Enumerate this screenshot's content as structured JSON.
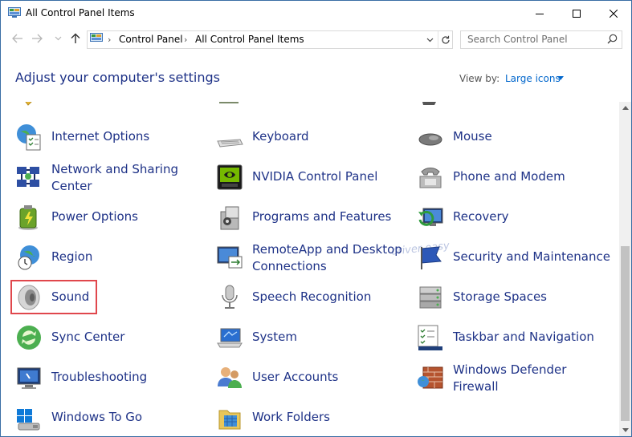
{
  "window": {
    "title": "All Control Panel Items",
    "title_icon": "control-panel-icon",
    "controls": [
      "minimize-icon",
      "maximize-icon",
      "close-icon"
    ]
  },
  "address": {
    "breadcrumbs": [
      "Control Panel",
      "All Control Panel Items"
    ],
    "search_placeholder": "Search Control Panel"
  },
  "header": {
    "title": "Adjust your computer's settings",
    "view_by_label": "View by:",
    "view_by_value": "Large icons"
  },
  "items": [
    {
      "label": "Internet Options",
      "icon": "globe-checklist-icon"
    },
    {
      "label": "Keyboard",
      "icon": "keyboard-icon"
    },
    {
      "label": "Mouse",
      "icon": "mouse-icon"
    },
    {
      "label": "Network and Sharing\nCenter",
      "icon": "network-icon"
    },
    {
      "label": "NVIDIA Control Panel",
      "icon": "nvidia-icon"
    },
    {
      "label": "Phone and Modem",
      "icon": "phone-icon"
    },
    {
      "label": "Power Options",
      "icon": "battery-icon"
    },
    {
      "label": "Programs and Features",
      "icon": "programs-icon"
    },
    {
      "label": "Recovery",
      "icon": "recovery-icon"
    },
    {
      "label": "Region",
      "icon": "globe-clock-icon"
    },
    {
      "label": "RemoteApp and Desktop\nConnections",
      "icon": "remote-desktop-icon"
    },
    {
      "label": "Security and Maintenance",
      "icon": "flag-icon"
    },
    {
      "label": "Sound",
      "icon": "speaker-icon"
    },
    {
      "label": "Speech Recognition",
      "icon": "microphone-icon"
    },
    {
      "label": "Storage Spaces",
      "icon": "storage-icon"
    },
    {
      "label": "Sync Center",
      "icon": "sync-icon"
    },
    {
      "label": "System",
      "icon": "laptop-icon"
    },
    {
      "label": "Taskbar and Navigation",
      "icon": "taskbar-icon"
    },
    {
      "label": "Troubleshooting",
      "icon": "troubleshoot-icon"
    },
    {
      "label": "User Accounts",
      "icon": "users-icon"
    },
    {
      "label": "Windows Defender\nFirewall",
      "icon": "firewall-icon"
    },
    {
      "label": "Windows To Go",
      "icon": "usb-drive-icon"
    },
    {
      "label": "Work Folders",
      "icon": "folder-icon"
    }
  ],
  "highlighted_item": "Sound",
  "colors": {
    "link_blue": "#1e3287",
    "accent_blue": "#0066cc",
    "highlight_red": "#e0474c"
  }
}
